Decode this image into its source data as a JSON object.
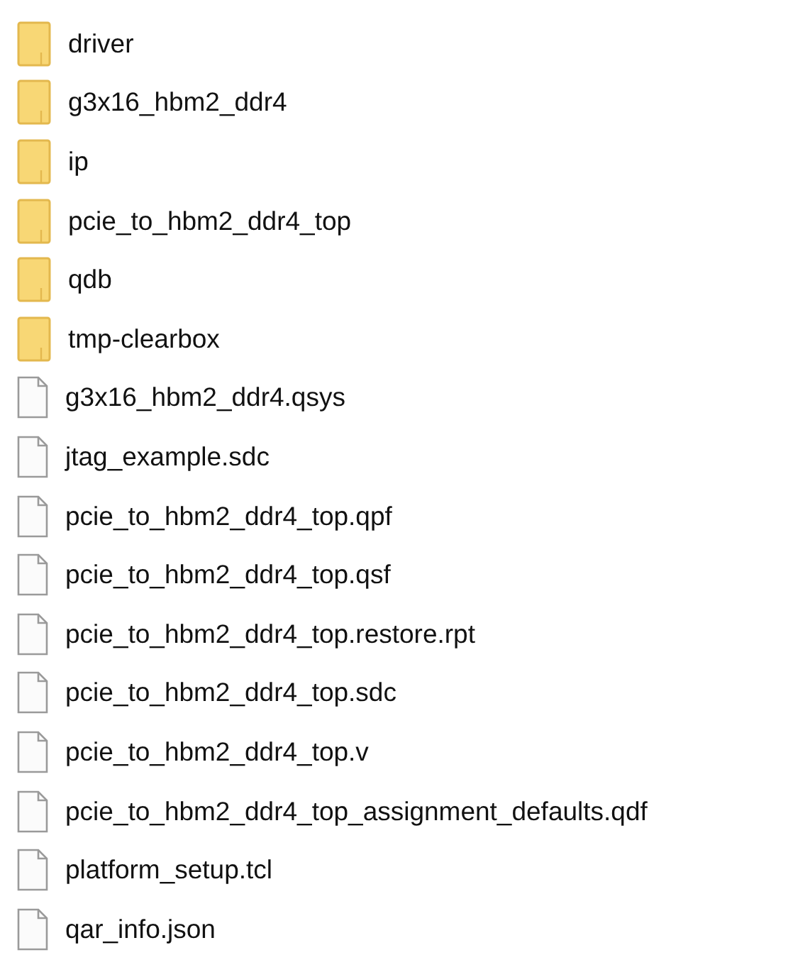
{
  "files": [
    {
      "kind": "folder",
      "name": "driver"
    },
    {
      "kind": "folder",
      "name": "g3x16_hbm2_ddr4"
    },
    {
      "kind": "folder",
      "name": "ip"
    },
    {
      "kind": "folder",
      "name": "pcie_to_hbm2_ddr4_top"
    },
    {
      "kind": "folder",
      "name": "qdb"
    },
    {
      "kind": "folder",
      "name": "tmp-clearbox"
    },
    {
      "kind": "file",
      "name": "g3x16_hbm2_ddr4.qsys"
    },
    {
      "kind": "file",
      "name": "jtag_example.sdc"
    },
    {
      "kind": "file",
      "name": "pcie_to_hbm2_ddr4_top.qpf"
    },
    {
      "kind": "file",
      "name": "pcie_to_hbm2_ddr4_top.qsf"
    },
    {
      "kind": "file",
      "name": "pcie_to_hbm2_ddr4_top.restore.rpt"
    },
    {
      "kind": "file",
      "name": "pcie_to_hbm2_ddr4_top.sdc"
    },
    {
      "kind": "file",
      "name": "pcie_to_hbm2_ddr4_top.v"
    },
    {
      "kind": "file",
      "name": "pcie_to_hbm2_ddr4_top_assignment_defaults.qdf"
    },
    {
      "kind": "file",
      "name": "platform_setup.tcl"
    },
    {
      "kind": "file",
      "name": "qar_info.json"
    }
  ]
}
